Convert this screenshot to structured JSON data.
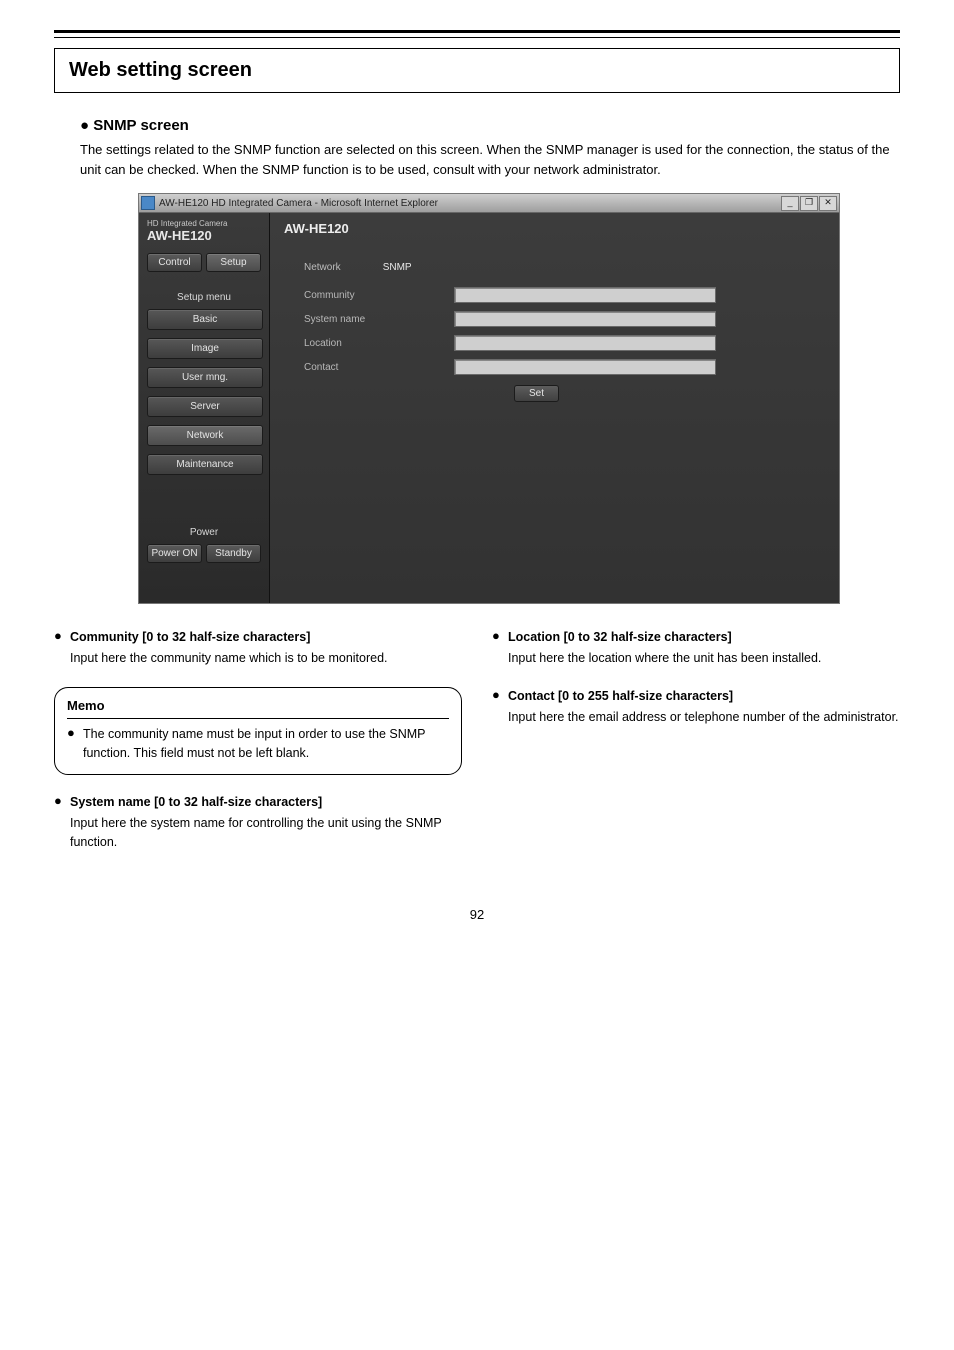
{
  "page_title": "Web setting screen",
  "page_number": "92",
  "snmp": {
    "heading": "● SNMP screen",
    "lead": "The settings related to the SNMP function are selected on this screen.\nWhen the SNMP manager is used for the connection, the status of the unit can be checked.\nWhen the SNMP function is to be used, consult with your network administrator."
  },
  "shot": {
    "titlebar": "AW-HE120 HD Integrated Camera - Microsoft Internet Explorer",
    "win": {
      "min": "_",
      "max": "❐",
      "close": "✕"
    },
    "brand_small": "HD Integrated Camera",
    "brand_large": "AW-HE120",
    "main_title": "AW-HE120",
    "top_btns": {
      "control": "Control",
      "setup": "Setup"
    },
    "setup_label": "Setup menu",
    "menu": [
      "Basic",
      "Image",
      "User mng.",
      "Server",
      "Network",
      "Maintenance"
    ],
    "power_label": "Power",
    "power_btns": {
      "on": "Power ON",
      "standby": "Standby"
    },
    "tabs": {
      "network": "Network",
      "snmp": "SNMP"
    },
    "form": {
      "community": "Community",
      "system_name": "System name",
      "location": "Location",
      "contact": "Contact",
      "set": "Set"
    }
  },
  "left": {
    "community": {
      "title": "Community",
      "meta": "[0 to 32 half-size characters]",
      "body": "Input here the community name which is to be monitored."
    },
    "memo_h": "Memo",
    "memo_body": "The community name must be input in order to use the SNMP function. This field must not be left blank.",
    "system_name": {
      "title": "System name",
      "meta": "[0 to 32 half-size characters]",
      "body": "Input here the system name for controlling the unit using the SNMP function."
    }
  },
  "right": {
    "location": {
      "title": "Location",
      "meta": "[0 to 32 half-size characters]",
      "body": "Input here the location where the unit has been installed."
    },
    "contact": {
      "title": "Contact",
      "meta": "[0 to 255 half-size characters]",
      "body": "Input here the email address or telephone number of the administrator."
    }
  }
}
